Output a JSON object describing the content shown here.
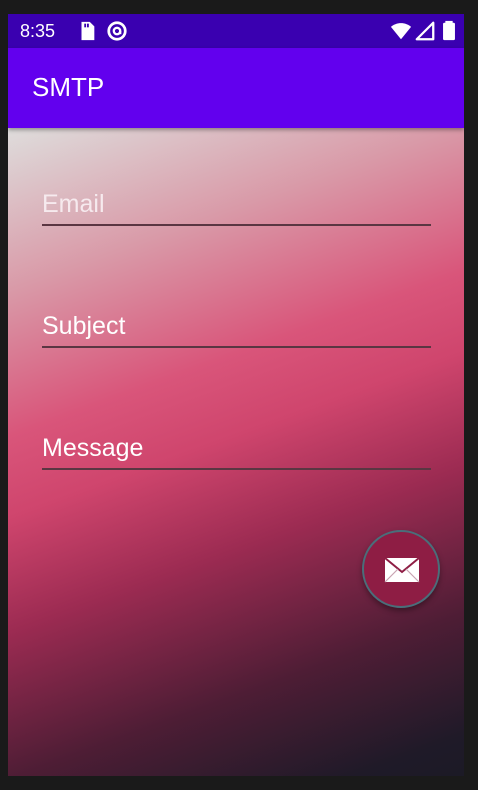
{
  "status_bar": {
    "time": "8:35",
    "left_icons": [
      "sd-card-icon",
      "circle-a-icon"
    ],
    "right_icons": [
      "wifi-icon",
      "signal-icon",
      "battery-icon"
    ]
  },
  "app_bar": {
    "title": "SMTP",
    "color": "#6200ee"
  },
  "form": {
    "email_placeholder": "Email",
    "subject_placeholder": "Subject",
    "message_placeholder": "Message"
  },
  "fab": {
    "icon": "envelope-icon",
    "color": "#8e1d44"
  }
}
